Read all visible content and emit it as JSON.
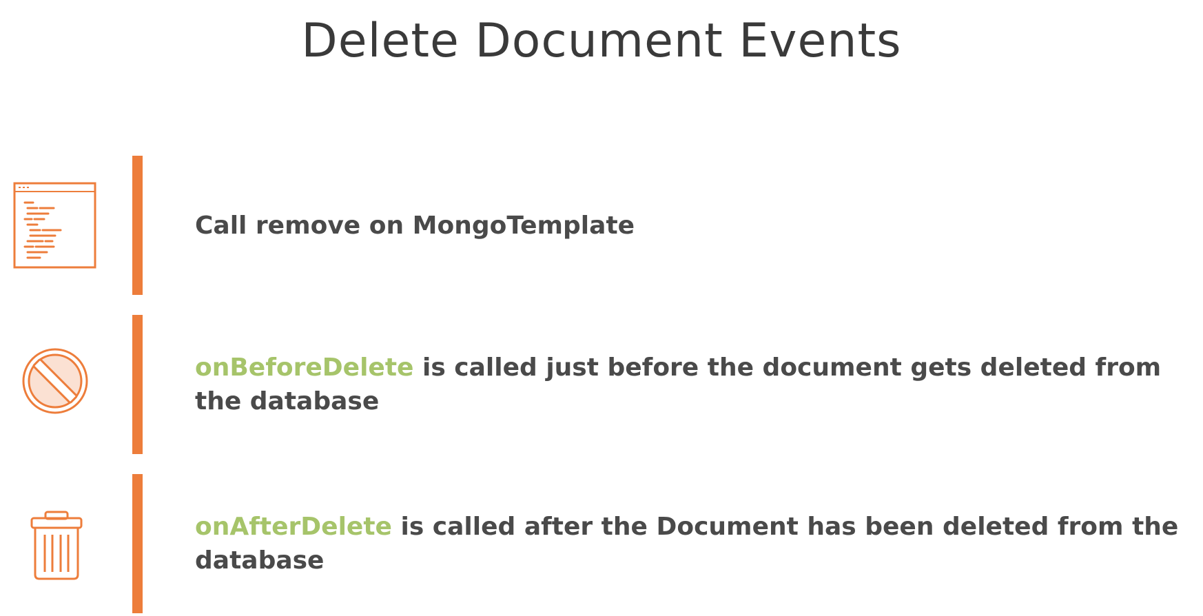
{
  "slide": {
    "title": "Delete Document Events"
  },
  "colors": {
    "accent": "#ed7d3b",
    "highlight": "#a6c46a",
    "text": "#4a4a4a",
    "title": "#3a3a3a"
  },
  "items": [
    {
      "icon": "code-document-icon",
      "highlight": "",
      "text": "Call remove on MongoTemplate"
    },
    {
      "icon": "prohibited-icon",
      "highlight": "onBeforeDelete",
      "text": " is called just before the document gets deleted from the database"
    },
    {
      "icon": "trash-can-icon",
      "highlight": "onAfterDelete",
      "text": " is called after the Document has been deleted from the database"
    }
  ]
}
